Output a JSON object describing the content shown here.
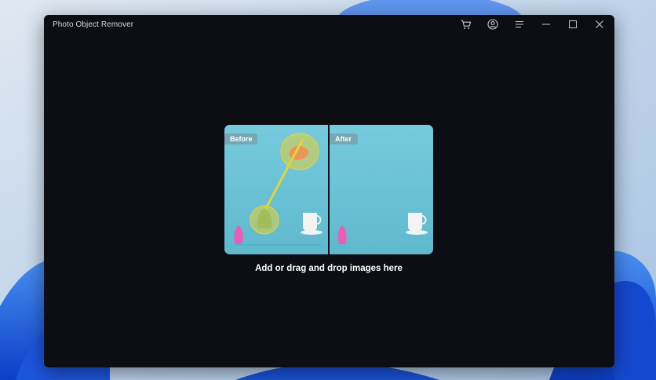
{
  "window": {
    "title": "Photo Object Remover"
  },
  "titlebar": {
    "buttons": [
      {
        "name": "cart",
        "icon": "cart-icon"
      },
      {
        "name": "account",
        "icon": "user-circle-icon"
      },
      {
        "name": "menu",
        "icon": "menu-icon"
      },
      {
        "name": "minimize",
        "icon": "minimize-icon"
      },
      {
        "name": "maximize",
        "icon": "maximize-icon"
      },
      {
        "name": "close",
        "icon": "close-icon"
      }
    ]
  },
  "preview": {
    "before_label": "Before",
    "after_label": "After"
  },
  "drop_zone": {
    "label": "Add or drag and drop images here"
  },
  "colors": {
    "window_bg": "#0d0e13",
    "preview_bg": "#6cc3d6",
    "highlight": "#e3d23a",
    "text": "#ffffff"
  }
}
